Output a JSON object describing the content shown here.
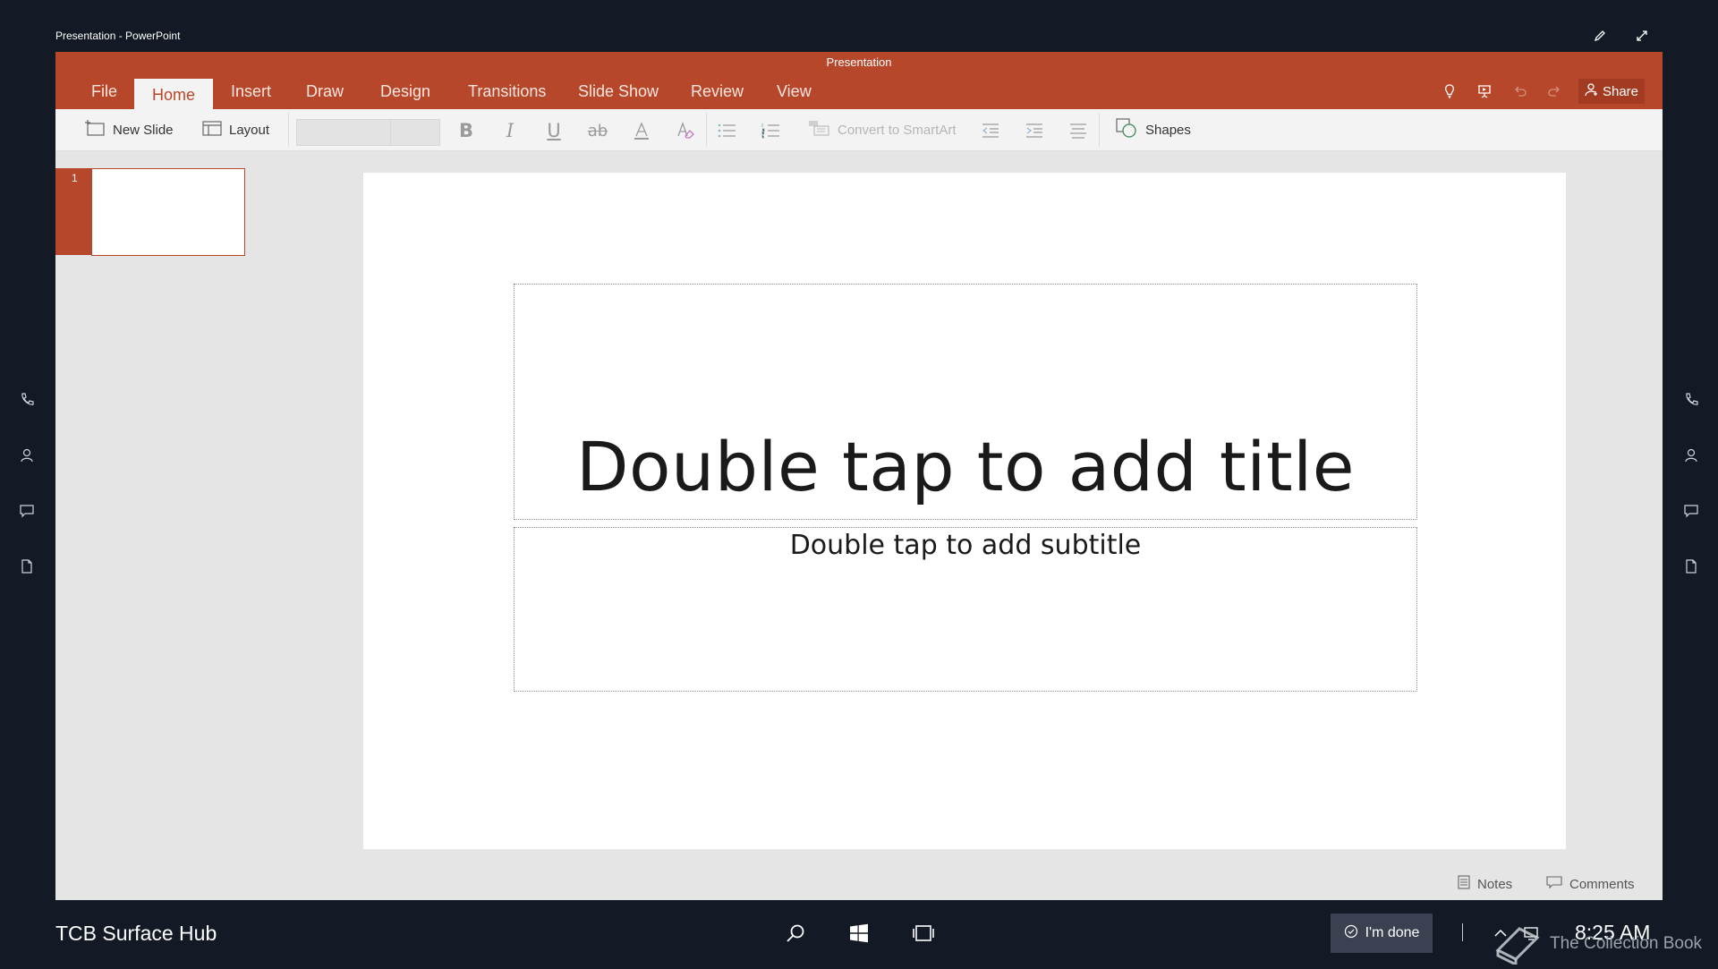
{
  "window": {
    "title": "Presentation - PowerPoint"
  },
  "app": {
    "doc_title": "Presentation",
    "tabs": [
      "File",
      "Home",
      "Insert",
      "Draw",
      "Design",
      "Transitions",
      "Slide Show",
      "Review",
      "View"
    ],
    "active_tab": "Home",
    "share_label": "Share",
    "accent_color": "#b7472a"
  },
  "ribbon": {
    "new_slide": "New Slide",
    "layout": "Layout",
    "convert_smartart": "Convert to SmartArt",
    "shapes": "Shapes",
    "format_icons": [
      "bold-icon",
      "italic-icon",
      "underline-icon",
      "strikethrough-icon",
      "font-color-icon",
      "clear-format-icon",
      "bullets-icon",
      "numbering-icon",
      "decrease-indent-icon",
      "increase-indent-icon",
      "align-icon"
    ]
  },
  "thumbnails": [
    {
      "number": "1"
    }
  ],
  "slide": {
    "title_placeholder": "Double tap to add title",
    "subtitle_placeholder": "Double tap to add subtitle"
  },
  "status_bar": {
    "notes": "Notes",
    "comments": "Comments"
  },
  "taskbar": {
    "device_name": "TCB Surface Hub",
    "done_label": "I'm done",
    "time": "8:25 AM"
  },
  "watermark": "The Collection Book"
}
